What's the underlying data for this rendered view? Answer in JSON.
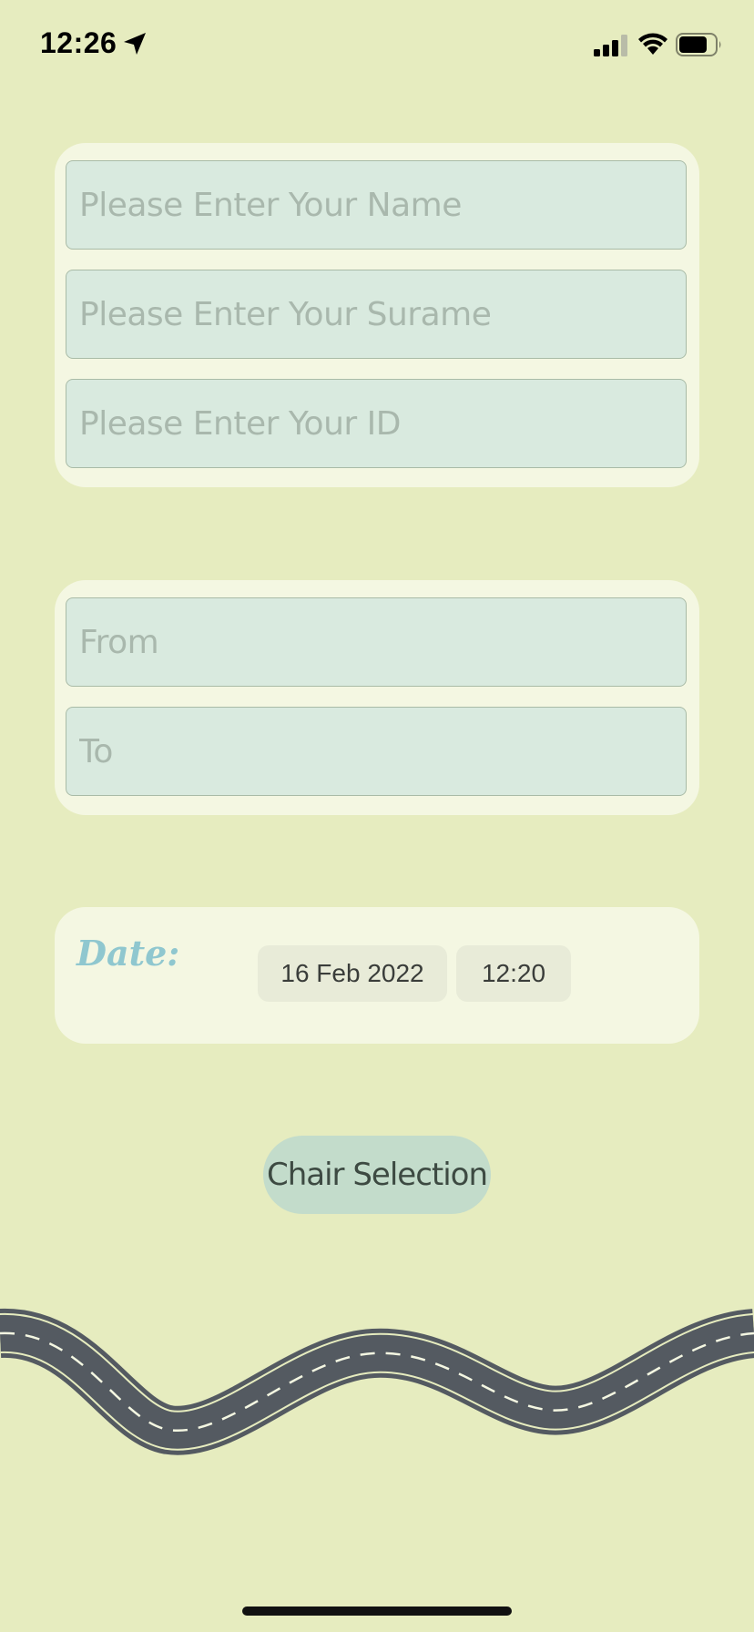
{
  "status_bar": {
    "time": "12:26"
  },
  "personal_info": {
    "name_placeholder": "Please Enter Your Name",
    "surname_placeholder": "Please Enter Your Surame",
    "id_placeholder": "Please Enter Your ID"
  },
  "route": {
    "from_placeholder": "From",
    "to_placeholder": "To"
  },
  "date_section": {
    "label": "Date:",
    "date_value": "16 Feb 2022",
    "time_value": "12:20"
  },
  "chair_button_label": "Chair Selection",
  "colors": {
    "background": "#e6ecbf",
    "card": "#f4f7e2",
    "field": "#d9eadf",
    "accent_date_label": "#8fc7cf",
    "button": "#c3dccb",
    "road": "#545a61"
  }
}
